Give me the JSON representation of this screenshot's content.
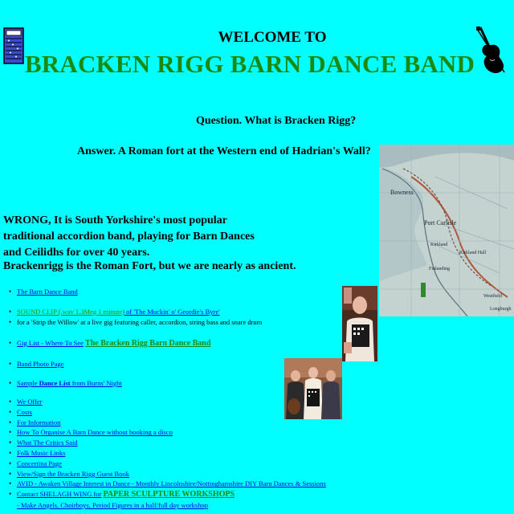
{
  "header": {
    "welcome": "WELCOME TO",
    "band_name": "BRACKEN RIGG BARN DANCE BAND"
  },
  "intro": {
    "question": "Question. What is Bracken Rigg?",
    "answer": "Answer. A Roman fort at the Western end of Hadrian's Wall?",
    "wrong": "WRONG, It is South Yorkshire's most popular traditional accordion band, playing for Barn Dances and Ceilidhs for over 40 years.",
    "ancient": "Brackenrigg is the Roman Fort, but we are nearly as ancient."
  },
  "map": {
    "labels": [
      "Bowness",
      "Port Carlisle",
      "Kirkland",
      "Kirkland Hall",
      "Finlanding",
      "Westfield",
      "Longburgh"
    ]
  },
  "links": {
    "barn_dance_band": "The Barn Dance Band",
    "sound_clip": "SOUND CLIP (.wav 1.3Meg 1 minute)",
    "sound_clip_of": " of 'The Muckin' o' Geordie's Byre'",
    "sound_clip_desc": "for a 'Strip the Willow' at a live gig featuring caller, accordion, string bass and snare drum",
    "gig_list": "Gig List - Where To See",
    "gig_list_band": "The Bracken Rigg Barn Dance Band",
    "band_photo": "Band Photo Page",
    "sample_prefix": "Sample",
    "sample_bold": "Dance List",
    "sample_suffix": "from Burns' Night",
    "menu": [
      "We Offer",
      "Costs",
      "For Information",
      "How To Organise A Barn Dance without booking a disco",
      "What The Critics Said",
      "Folk Music Links",
      "Concertina Page",
      "View/Sign the Bracken Rigg Guest Book",
      "AVID - Awaken Village Interest in Dance - Monthly Lincolnshire/Nottinghamshire DIY Barn Dances & Sessions"
    ],
    "shelagh_prefix": "Contact SHELAGH WING for",
    "shelagh_green": "PAPER SCULPTURE WORKSHOPS",
    "shelagh_sub": "- Make Angels, Choirboys, Period Figures in a half/full day workshop"
  },
  "colors": {
    "background": "#00ffff",
    "title_green": "#1c8a10",
    "link_blue": "#0000ee"
  }
}
